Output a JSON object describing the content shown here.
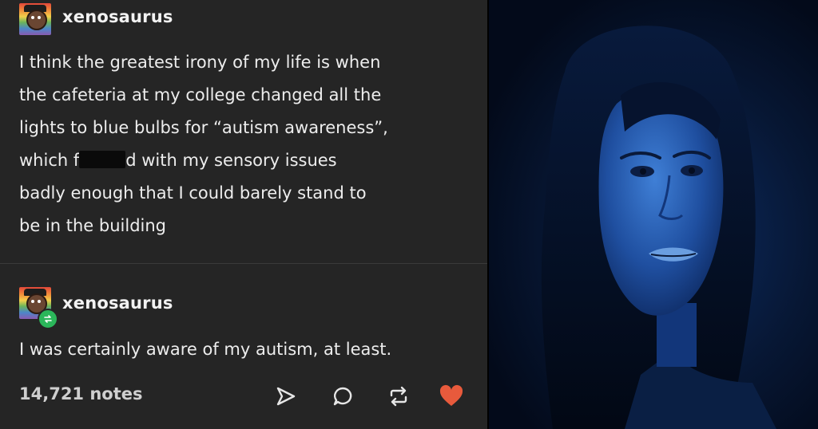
{
  "posts": [
    {
      "username": "xenosaurus",
      "text_lines": [
        "I think the greatest irony of my life is when",
        "the cafeteria at my college changed all the",
        "lights to blue bulbs for “autism awareness”,"
      ],
      "line4_before": "which f",
      "line4_after": "d with my sensory issues",
      "text_lines_end": [
        "badly enough that I could barely stand to",
        "be in the building"
      ]
    },
    {
      "username": "xenosaurus",
      "text": "I was certainly aware of my autism, at least."
    }
  ],
  "footer": {
    "notes": "14,721 notes",
    "actions": [
      "share-icon",
      "comment-icon",
      "reblog-icon",
      "like-icon"
    ]
  },
  "colors": {
    "background": "#252525",
    "text": "#ededed",
    "reblog_green": "#2bb65a",
    "like_red": "#e85a3c",
    "photo_blue": "#0c2a5e"
  }
}
